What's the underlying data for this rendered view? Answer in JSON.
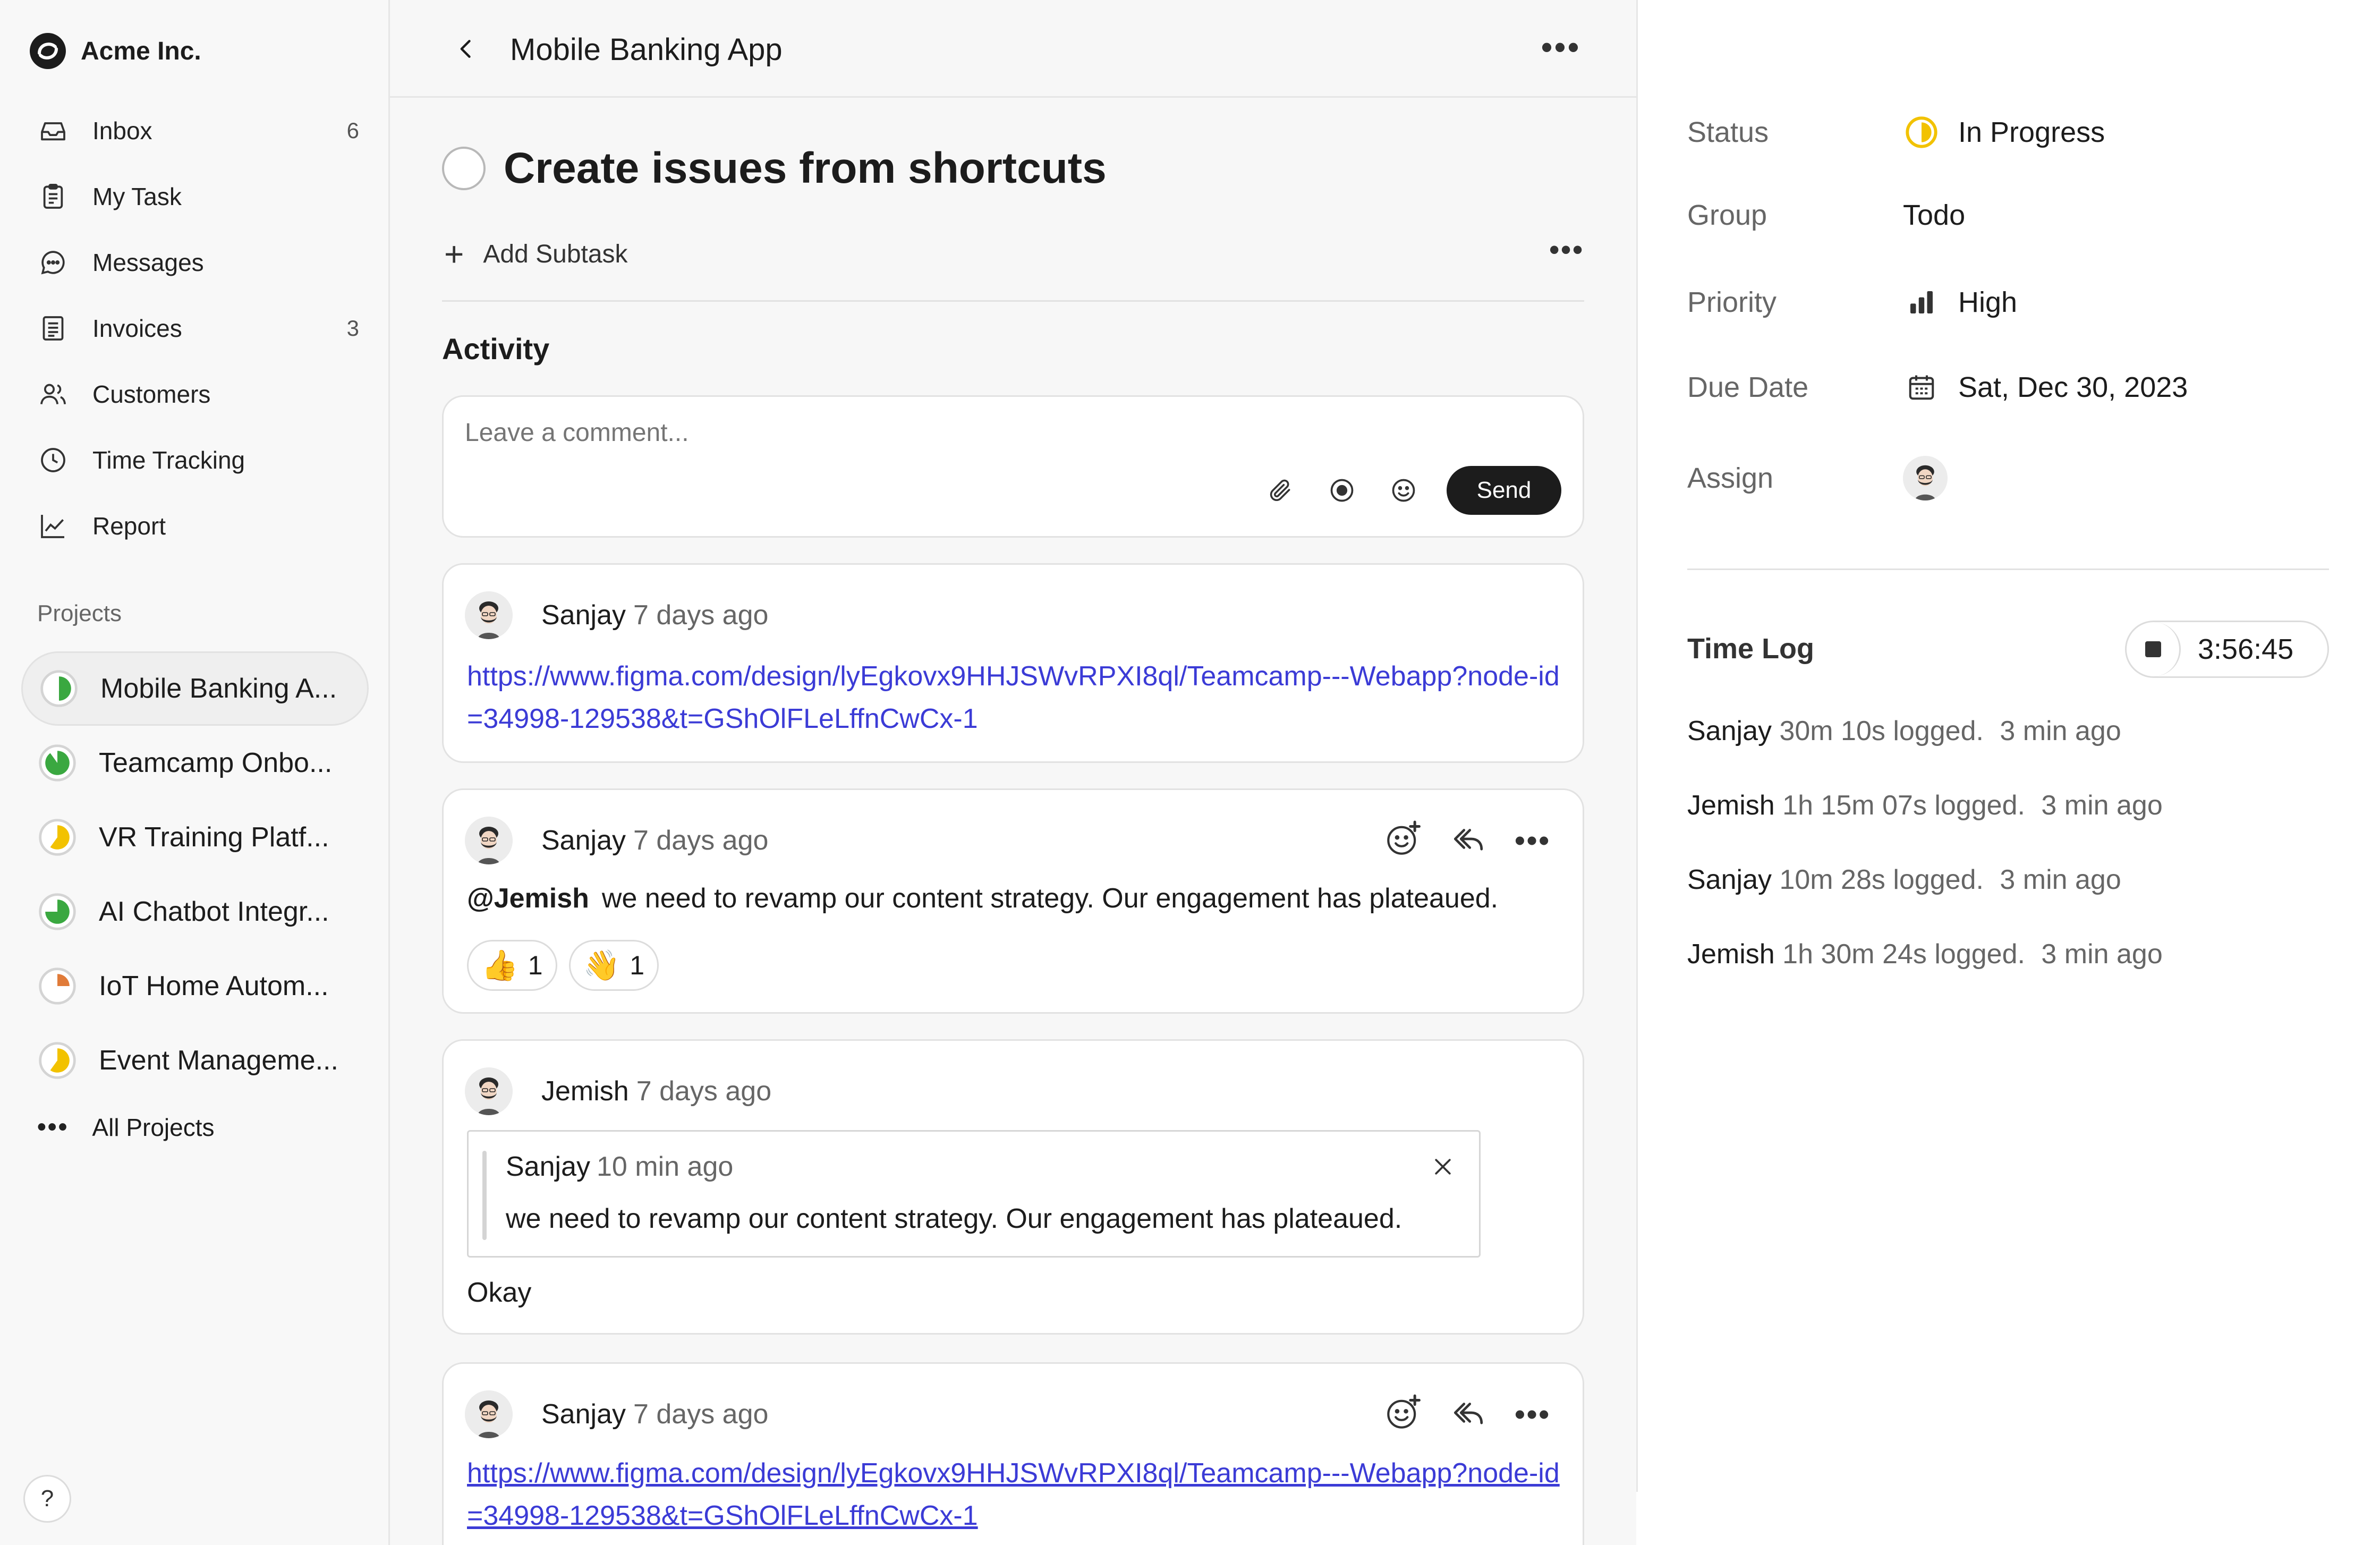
{
  "app": {
    "name": "Acme Inc."
  },
  "sidebar": {
    "items": [
      {
        "label": "Inbox",
        "count": "6",
        "icon": "inbox-icon"
      },
      {
        "label": "My Task",
        "count": "",
        "icon": "clipboard-icon"
      },
      {
        "label": "Messages",
        "count": "",
        "icon": "chat-icon"
      },
      {
        "label": "Invoices",
        "count": "3",
        "icon": "invoice-icon"
      },
      {
        "label": "Customers",
        "count": "",
        "icon": "users-icon"
      },
      {
        "label": "Time Tracking",
        "count": "",
        "icon": "clock-icon"
      },
      {
        "label": "Report",
        "count": "",
        "icon": "chart-line-icon"
      }
    ],
    "projects_label": "Projects",
    "projects": [
      {
        "label": "Mobile Banking A...",
        "color": "#3aa840",
        "progress": 0.5
      },
      {
        "label": "Teamcamp Onbo...",
        "color": "#3aa840",
        "progress": 0.9
      },
      {
        "label": "VR Training Platf...",
        "color": "#f2c200",
        "progress": 0.6
      },
      {
        "label": "AI Chatbot Integr...",
        "color": "#3aa840",
        "progress": 0.75
      },
      {
        "label": "IoT Home Autom...",
        "color": "#e07b39",
        "progress": 0.25
      },
      {
        "label": "Event Manageme...",
        "color": "#f2c200",
        "progress": 0.6
      }
    ],
    "all_projects": "All Projects",
    "help": "?"
  },
  "header": {
    "title": "Mobile Banking App"
  },
  "task": {
    "title": "Create issues from shortcuts",
    "add_subtask": "Add Subtask",
    "activity_label": "Activity"
  },
  "comment": {
    "placeholder": "Leave a comment...",
    "send": "Send"
  },
  "posts": [
    {
      "author": "Sanjay",
      "time": "7 days ago",
      "link": "https://www.figma.com/design/lyEgkovx9HHJSWvRPXI8ql/Teamcamp---Webapp?node-id=34998-129538&t=GShOlFLeLffnCwCx-1"
    },
    {
      "author": "Sanjay",
      "time": "7 days ago",
      "mention": "@Jemish",
      "text": "we need to revamp our content strategy. Our engagement has plateaued.",
      "reactions": [
        {
          "emoji": "👍",
          "count": "1"
        },
        {
          "emoji": "👋",
          "count": "1"
        }
      ]
    },
    {
      "author": "Jemish",
      "time": "7 days ago",
      "quote": {
        "author": "Sanjay",
        "time": "10 min ago",
        "text": "we need to revamp our content strategy. Our engagement has plateaued."
      },
      "text": "Okay"
    },
    {
      "author": "Sanjay",
      "time": "7 days ago",
      "link": "https://www.figma.com/design/lyEgkovx9HHJSWvRPXI8ql/Teamcamp---Webapp?node-id=34998-129538&t=GShOlFLeLffnCwCx-1"
    }
  ],
  "details": {
    "status": {
      "label": "Status",
      "value": "In Progress",
      "color": "#f2c200"
    },
    "group": {
      "label": "Group",
      "value": "Todo"
    },
    "priority": {
      "label": "Priority",
      "value": "High"
    },
    "due_date": {
      "label": "Due Date",
      "value": "Sat, Dec 30, 2023"
    },
    "assign": {
      "label": "Assign"
    }
  },
  "time_log": {
    "title": "Time Log",
    "timer": "3:56:45",
    "entries": [
      {
        "who": "Sanjay",
        "what": "30m 10s logged.",
        "ago": "3 min ago"
      },
      {
        "who": "Jemish",
        "what": "1h 15m 07s logged.",
        "ago": "3 min ago"
      },
      {
        "who": "Sanjay",
        "what": "10m 28s logged.",
        "ago": "3 min ago"
      },
      {
        "who": "Jemish",
        "what": "1h 30m 24s logged.",
        "ago": "3 min ago"
      }
    ]
  }
}
